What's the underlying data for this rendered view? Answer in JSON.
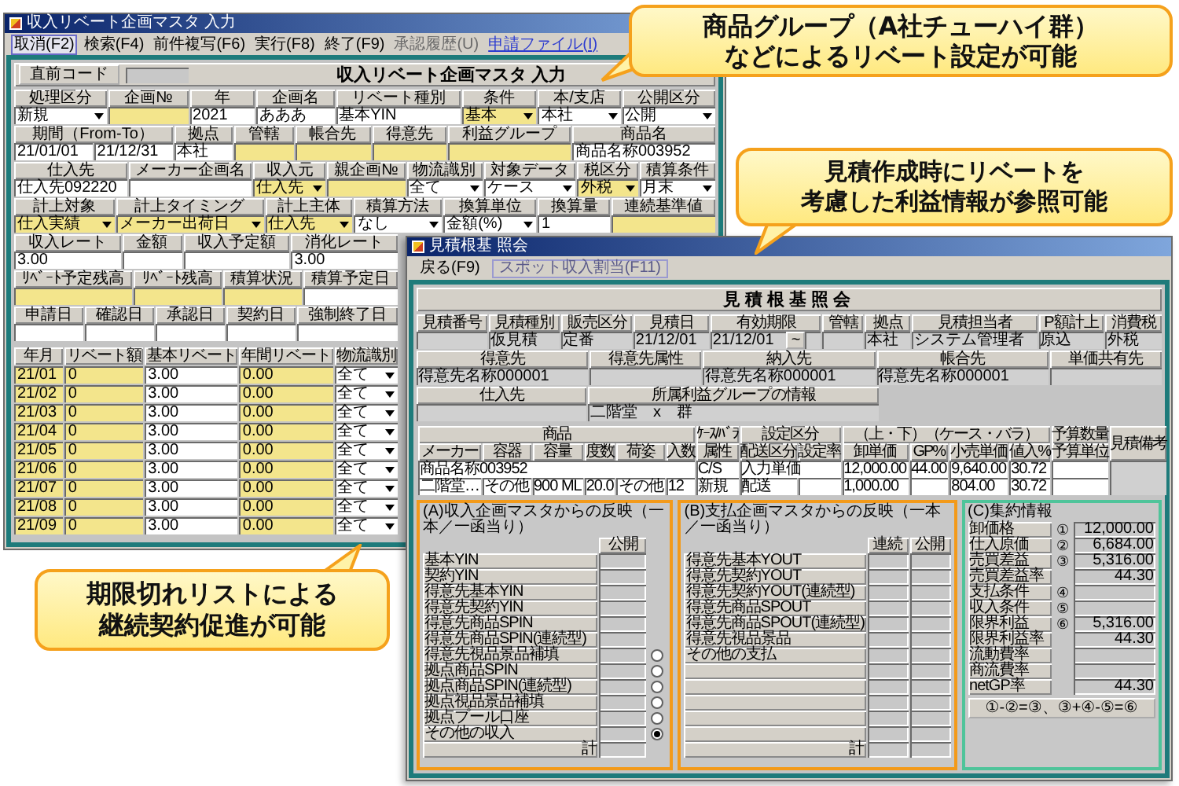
{
  "main_window": {
    "title": "収入リベート企画マスタ 入力",
    "menu": [
      {
        "label": "取消(F2)",
        "selected": true,
        "disabled": false,
        "kind": "command"
      },
      {
        "label": "検索(F4)",
        "selected": false,
        "disabled": false,
        "kind": "command"
      },
      {
        "label": "前件複写(F6)",
        "selected": false,
        "disabled": false,
        "kind": "command"
      },
      {
        "label": "実行(F8)",
        "selected": false,
        "disabled": false,
        "kind": "command"
      },
      {
        "label": "終了(F9)",
        "selected": false,
        "disabled": false,
        "kind": "command"
      },
      {
        "label": "承認履歴(U)",
        "selected": false,
        "disabled": true,
        "kind": "command"
      },
      {
        "label": "申請ファイル(I)",
        "selected": false,
        "disabled": false,
        "kind": "link"
      }
    ],
    "code_button": "直前コード",
    "heading": "収入リベート企画マスタ 入力",
    "form_rows": [
      [
        {
          "label": "処理区分",
          "fields": [
            {
              "kind": "select",
              "value": "新規",
              "highlighted": false
            }
          ]
        },
        {
          "label": "企画№",
          "fields": [
            {
              "kind": "input",
              "highlighted": true
            }
          ]
        },
        {
          "label": "年",
          "fields": [
            {
              "kind": "input",
              "value": "2021",
              "highlighted": false
            }
          ]
        },
        {
          "label": "企画名",
          "fields": [
            {
              "kind": "input",
              "value": "あああ",
              "highlighted": false
            }
          ]
        },
        {
          "label": "リベート種別",
          "fields": [
            {
              "kind": "input",
              "value": "基本YIN",
              "highlighted": false
            }
          ]
        },
        {
          "label": "条件",
          "fields": [
            {
              "kind": "select",
              "value": "基本",
              "highlighted": true
            }
          ]
        },
        {
          "label": "本/支店",
          "fields": [
            {
              "kind": "select",
              "value": "本社",
              "highlighted": false
            }
          ]
        },
        {
          "label": "公開区分",
          "fields": [
            {
              "kind": "select",
              "value": "公開",
              "highlighted": false
            }
          ]
        }
      ],
      [
        {
          "label": "期間（From-To）",
          "fields": [
            {
              "kind": "input",
              "value": "21/01/01",
              "highlighted": false
            },
            {
              "kind": "input",
              "value": "21/12/31",
              "highlighted": false
            }
          ]
        },
        {
          "label": "拠点",
          "fields": [
            {
              "kind": "input",
              "value": "本社",
              "highlighted": false
            }
          ]
        },
        {
          "label": "管轄",
          "fields": [
            {
              "kind": "input",
              "highlighted": true
            }
          ]
        },
        {
          "label": "帳合先",
          "fields": [
            {
              "kind": "input",
              "highlighted": true
            }
          ]
        },
        {
          "label": "得意先",
          "fields": [
            {
              "kind": "input",
              "highlighted": true
            }
          ]
        },
        {
          "label": "利益グループ",
          "fields": [
            {
              "kind": "input",
              "highlighted": true
            }
          ]
        },
        {
          "label": "商品名",
          "fields": [
            {
              "kind": "input",
              "value": "商品名称003952",
              "highlighted": false
            }
          ]
        }
      ],
      [
        {
          "label": "仕入先",
          "fields": [
            {
              "kind": "input",
              "value": "仕入先092220",
              "highlighted": false
            }
          ]
        },
        {
          "label": "メーカー企画名",
          "fields": [
            {
              "kind": "input",
              "highlighted": false
            }
          ]
        },
        {
          "label": "収入元",
          "fields": [
            {
              "kind": "select",
              "value": "仕入先",
              "highlighted": true
            }
          ]
        },
        {
          "label": "親企画№",
          "fields": [
            {
              "kind": "input",
              "highlighted": true
            }
          ]
        },
        {
          "label": "物流識別",
          "fields": [
            {
              "kind": "select",
              "value": "全て",
              "highlighted": false
            }
          ]
        },
        {
          "label": "対象データ",
          "fields": [
            {
              "kind": "select",
              "value": "ケース",
              "highlighted": false
            }
          ]
        },
        {
          "label": "税区分",
          "fields": [
            {
              "kind": "select",
              "value": "外税",
              "highlighted": true
            }
          ]
        },
        {
          "label": "積算条件",
          "fields": [
            {
              "kind": "select",
              "value": "月末",
              "highlighted": false
            }
          ]
        }
      ],
      [
        {
          "label": "計上対象",
          "fields": [
            {
              "kind": "select",
              "value": "仕入実績",
              "highlighted": true
            }
          ]
        },
        {
          "label": "計上タイミング",
          "fields": [
            {
              "kind": "select",
              "value": "メーカー出荷日",
              "highlighted": true
            }
          ]
        },
        {
          "label": "計上主体",
          "fields": [
            {
              "kind": "select",
              "value": "仕入先",
              "highlighted": true
            }
          ]
        },
        {
          "label": "積算方法",
          "fields": [
            {
              "kind": "select",
              "value": "なし",
              "highlighted": false
            }
          ]
        },
        {
          "label": "換算単位",
          "fields": [
            {
              "kind": "select",
              "value": "金額(%)",
              "highlighted": false
            }
          ]
        },
        {
          "label": "換算量",
          "fields": [
            {
              "kind": "input",
              "value": "1",
              "highlighted": false
            }
          ]
        },
        {
          "label": "連続基準値",
          "fields": [
            {
              "kind": "input",
              "highlighted": true
            }
          ]
        }
      ]
    ],
    "lower_rows": [
      [
        {
          "label": "収入レート",
          "fields": [
            {
              "kind": "input",
              "value": "3.00",
              "highlighted": false
            }
          ]
        },
        {
          "label": "金額",
          "fields": [
            {
              "kind": "input",
              "highlighted": false
            }
          ]
        },
        {
          "label": "収入予定額",
          "fields": [
            {
              "kind": "input",
              "highlighted": false
            }
          ]
        },
        {
          "label": "消化レート",
          "fields": [
            {
              "kind": "input",
              "value": "3.00",
              "highlighted": false
            }
          ]
        }
      ],
      [
        {
          "label": "ﾘﾍﾞｰﾄ予定残高",
          "fields": [
            {
              "kind": "input",
              "highlighted": true
            }
          ]
        },
        {
          "label": "ﾘﾍﾞｰﾄ残高",
          "fields": [
            {
              "kind": "input",
              "highlighted": true
            }
          ]
        },
        {
          "label": "積算状況",
          "fields": [
            {
              "kind": "input",
              "highlighted": true
            }
          ]
        },
        {
          "label": "積算予定日",
          "fields": [
            {
              "kind": "input",
              "highlighted": false
            }
          ]
        }
      ],
      [
        {
          "label": "申請日",
          "fields": [
            {
              "kind": "input",
              "highlighted": false
            }
          ]
        },
        {
          "label": "確認日",
          "fields": [
            {
              "kind": "input",
              "highlighted": false
            }
          ]
        },
        {
          "label": "承認日",
          "fields": [
            {
              "kind": "input",
              "highlighted": false
            }
          ]
        },
        {
          "label": "契約日",
          "fields": [
            {
              "kind": "input",
              "highlighted": false
            }
          ]
        },
        {
          "label": "強制終了日",
          "fields": [
            {
              "kind": "input",
              "highlighted": false
            }
          ]
        }
      ]
    ],
    "monthly_table": {
      "columns": [
        "年月",
        "リベート額",
        "基本リベート",
        "年間リベート",
        "物流識別"
      ],
      "rows": [
        [
          {
            "kind": "input",
            "value": "21/01",
            "highlighted": true
          },
          {
            "kind": "input",
            "value": "0",
            "highlighted": true
          },
          {
            "kind": "input",
            "value": "3.00",
            "highlighted": false
          },
          {
            "kind": "input",
            "value": "0.00",
            "highlighted": true
          },
          {
            "kind": "select",
            "value": "全て",
            "highlighted": false
          }
        ],
        [
          {
            "kind": "input",
            "value": "21/02",
            "highlighted": true
          },
          {
            "kind": "input",
            "value": "0",
            "highlighted": true
          },
          {
            "kind": "input",
            "value": "3.00",
            "highlighted": false
          },
          {
            "kind": "input",
            "value": "0.00",
            "highlighted": true
          },
          {
            "kind": "select",
            "value": "全て",
            "highlighted": false
          }
        ],
        [
          {
            "kind": "input",
            "value": "21/03",
            "highlighted": true
          },
          {
            "kind": "input",
            "value": "0",
            "highlighted": true
          },
          {
            "kind": "input",
            "value": "3.00",
            "highlighted": false
          },
          {
            "kind": "input",
            "value": "0.00",
            "highlighted": true
          },
          {
            "kind": "select",
            "value": "全て",
            "highlighted": false
          }
        ],
        [
          {
            "kind": "input",
            "value": "21/04",
            "highlighted": true
          },
          {
            "kind": "input",
            "value": "0",
            "highlighted": true
          },
          {
            "kind": "input",
            "value": "3.00",
            "highlighted": false
          },
          {
            "kind": "input",
            "value": "0.00",
            "highlighted": true
          },
          {
            "kind": "select",
            "value": "全て",
            "highlighted": false
          }
        ],
        [
          {
            "kind": "input",
            "value": "21/05",
            "highlighted": true
          },
          {
            "kind": "input",
            "value": "0",
            "highlighted": true
          },
          {
            "kind": "input",
            "value": "3.00",
            "highlighted": false
          },
          {
            "kind": "input",
            "value": "0.00",
            "highlighted": true
          },
          {
            "kind": "select",
            "value": "全て",
            "highlighted": false
          }
        ],
        [
          {
            "kind": "input",
            "value": "21/06",
            "highlighted": true
          },
          {
            "kind": "input",
            "value": "0",
            "highlighted": true
          },
          {
            "kind": "input",
            "value": "3.00",
            "highlighted": false
          },
          {
            "kind": "input",
            "value": "0.00",
            "highlighted": true
          },
          {
            "kind": "select",
            "value": "全て",
            "highlighted": false
          }
        ],
        [
          {
            "kind": "input",
            "value": "21/07",
            "highlighted": true
          },
          {
            "kind": "input",
            "value": "0",
            "highlighted": true
          },
          {
            "kind": "input",
            "value": "3.00",
            "highlighted": false
          },
          {
            "kind": "input",
            "value": "0.00",
            "highlighted": true
          },
          {
            "kind": "select",
            "value": "全て",
            "highlighted": false
          }
        ],
        [
          {
            "kind": "input",
            "value": "21/08",
            "highlighted": true
          },
          {
            "kind": "input",
            "value": "0",
            "highlighted": true
          },
          {
            "kind": "input",
            "value": "3.00",
            "highlighted": false
          },
          {
            "kind": "input",
            "value": "0.00",
            "highlighted": true
          },
          {
            "kind": "select",
            "value": "全て",
            "highlighted": false
          }
        ],
        [
          {
            "kind": "input",
            "value": "21/09",
            "highlighted": true
          },
          {
            "kind": "input",
            "value": "0",
            "highlighted": true
          },
          {
            "kind": "input",
            "value": "3.00",
            "highlighted": false
          },
          {
            "kind": "input",
            "value": "0.00",
            "highlighted": true
          },
          {
            "kind": "select",
            "value": "全て",
            "highlighted": false
          }
        ]
      ]
    }
  },
  "quote_window": {
    "title": "見積根基 照会",
    "toolbar": [
      {
        "label": "戻る(F9)",
        "disabled": false
      },
      {
        "label": "スポット収入割当(F11)",
        "disabled": true
      }
    ],
    "heading": "見積根基照会",
    "form_rows": [
      [
        {
          "label": "見積番号",
          "fields": [
            {
              "kind": "readonly"
            }
          ]
        },
        {
          "label": "見積種別",
          "fields": [
            {
              "kind": "readonly",
              "value": "仮見積"
            }
          ]
        },
        {
          "label": "販売区分",
          "fields": [
            {
              "kind": "readonly",
              "value": "定番"
            }
          ]
        },
        {
          "label": "見積日",
          "fields": [
            {
              "kind": "readonly",
              "value": "21/12/01"
            }
          ]
        },
        {
          "label": "有効期限",
          "fields": [
            {
              "kind": "readonly",
              "value": "21/12/01"
            },
            {
              "kind": "button",
              "value": "~"
            },
            {
              "kind": "readonly"
            }
          ]
        },
        {
          "label": "管轄",
          "fields": [
            {
              "kind": "readonly"
            }
          ]
        },
        {
          "label": "拠点",
          "fields": [
            {
              "kind": "readonly",
              "value": "本社"
            }
          ]
        },
        {
          "label": "見積担当者",
          "fields": [
            {
              "kind": "readonly",
              "value": "システム管理者"
            }
          ]
        },
        {
          "label": "P額計上",
          "fields": [
            {
              "kind": "readonly",
              "value": "原込"
            }
          ]
        },
        {
          "label": "消費税",
          "fields": [
            {
              "kind": "readonly",
              "value": "外税"
            }
          ]
        }
      ],
      [
        {
          "label": "得意先",
          "fields": [
            {
              "kind": "readonly",
              "value": "得意先名称000001"
            }
          ]
        },
        {
          "label": "得意先属性",
          "fields": [
            {
              "kind": "readonly"
            }
          ]
        },
        {
          "label": "納入先",
          "fields": [
            {
              "kind": "readonly",
              "value": "得意先名称000001"
            }
          ]
        },
        {
          "label": "帳合先",
          "fields": [
            {
              "kind": "readonly",
              "value": "得意先名称000001"
            }
          ]
        },
        {
          "label": "単価共有先",
          "fields": [
            {
              "kind": "readonly"
            }
          ]
        }
      ],
      [
        {
          "label": "仕入先",
          "fields": [
            {
              "kind": "readonly"
            }
          ]
        },
        {
          "label": "所属利益グループの情報",
          "fields": [
            {
              "kind": "readonly",
              "value": "二階堂　x　群"
            }
          ]
        }
      ]
    ],
    "product_table": {
      "header_top": [
        {
          "text": "商品",
          "colspan": 6
        },
        {
          "text": "ｹｰｽ/ﾊﾞﾗ"
        },
        {
          "text": "設定区分",
          "colspan": 2
        },
        {
          "text": "（上・下）（ケース・バラ）",
          "colspan": 4
        },
        {
          "text": "予算数量"
        },
        {
          "text": "見積備考",
          "rowspan": 2
        }
      ],
      "header_bottom": [
        "メーカー",
        "容器",
        "容量",
        "度数",
        "荷姿",
        "入数",
        "属性",
        "配送区分",
        "設定率",
        "卸単価",
        "GP%",
        "小売単価",
        "値入%",
        "予算単位"
      ],
      "rows": [
        [
          {
            "text": "商品名称003952",
            "colspan": 6
          },
          {
            "text": "C/S"
          },
          {
            "text": "入力単価",
            "colspan": 2
          },
          {
            "text": "12,000.00"
          },
          {
            "text": "44.00"
          },
          {
            "text": "9,640.00"
          },
          {
            "text": "30.72"
          },
          {},
          {
            "rowspan": 2
          }
        ],
        [
          {
            "text": "二階堂…"
          },
          {
            "text": "その他"
          },
          {
            "text": "900 ML"
          },
          {
            "text": "20.0"
          },
          {
            "text": "その他"
          },
          {
            "text": "12"
          },
          {
            "text": "新規"
          },
          {
            "text": "配送"
          },
          {},
          {
            "text": "1,000.00"
          },
          {},
          {
            "text": "804.00"
          },
          {
            "text": "30.72"
          },
          {}
        ]
      ]
    },
    "panel_a": {
      "title": "(A)収入企画マスタからの反映（一本／一函当り）",
      "columns": [
        "公開"
      ],
      "rows": [
        {
          "label": "基本YIN",
          "kind": "plain"
        },
        {
          "label": "契約YIN",
          "kind": "plain"
        },
        {
          "label": "得意先基本YIN",
          "kind": "plain"
        },
        {
          "label": "得意先契約YIN",
          "kind": "plain"
        },
        {
          "label": "得意先商品SPIN",
          "kind": "plain"
        },
        {
          "label": "得意先商品SPIN(連続型)",
          "kind": "plain"
        },
        {
          "label": "得意先視品景品補填",
          "kind": "radio",
          "selected": false
        },
        {
          "label": "拠点商品SPIN",
          "kind": "radio",
          "selected": false
        },
        {
          "label": "拠点商品SPIN(連続型)",
          "kind": "radio",
          "selected": false
        },
        {
          "label": "拠点視品景品補填",
          "kind": "radio",
          "selected": false
        },
        {
          "label": "拠点プール口座",
          "kind": "radio",
          "selected": false
        },
        {
          "label": "その他の収入",
          "kind": "radio",
          "selected": true
        }
      ],
      "total_label": "計"
    },
    "panel_b": {
      "title": "(B)支払企画マスタからの反映（一本／一函当り）",
      "columns": [
        "連続",
        "公開"
      ],
      "rows": [
        {
          "label": "得意先基本YOUT",
          "kind": "plain"
        },
        {
          "label": "得意先契約YOUT",
          "kind": "plain"
        },
        {
          "label": "得意先契約YOUT(連続型)",
          "kind": "plain"
        },
        {
          "label": "得意先商品SPOUT",
          "kind": "plain"
        },
        {
          "label": "得意先商品SPOUT(連続型)",
          "kind": "plain"
        },
        {
          "label": "得意先視品景品",
          "kind": "plain"
        },
        {
          "label": "その他の支払",
          "kind": "plain"
        },
        {
          "kind": "blank"
        },
        {
          "kind": "blank"
        },
        {
          "kind": "blank"
        },
        {
          "kind": "blank"
        },
        {
          "kind": "blank"
        }
      ],
      "total_label": "計"
    },
    "panel_c": {
      "title": "(C)集約情報",
      "rows": [
        {
          "label": "卸価格",
          "mark": "①",
          "value": "12,000.00"
        },
        {
          "label": "仕入原価",
          "mark": "②",
          "value": "6,684.00"
        },
        {
          "label": "売買差益",
          "mark": "③",
          "value": "5,316.00"
        },
        {
          "label": "売買差益率",
          "value": "44.30"
        },
        {
          "label": "支払条件",
          "mark": "④"
        },
        {
          "label": "収入条件",
          "mark": "⑤"
        },
        {
          "label": "限界利益",
          "mark": "⑥",
          "value": "5,316.00"
        },
        {
          "label": "限界利益率",
          "value": "44.30"
        },
        {
          "label": "流動費率"
        },
        {
          "label": "商流費率"
        },
        {
          "label": "netGP率",
          "value": "44.30"
        }
      ],
      "formula": "①-②=③、③+④-⑤=⑥"
    }
  },
  "callouts": [
    {
      "lines": [
        "商品グループ（A社チューハイ群）",
        "などによるリベート設定が可能"
      ]
    },
    {
      "lines": [
        "見積作成時にリベートを",
        "考慮した利益情報が参照可能"
      ]
    },
    {
      "lines": [
        "期限切れリストによる",
        "継続契約促進が可能"
      ]
    }
  ]
}
